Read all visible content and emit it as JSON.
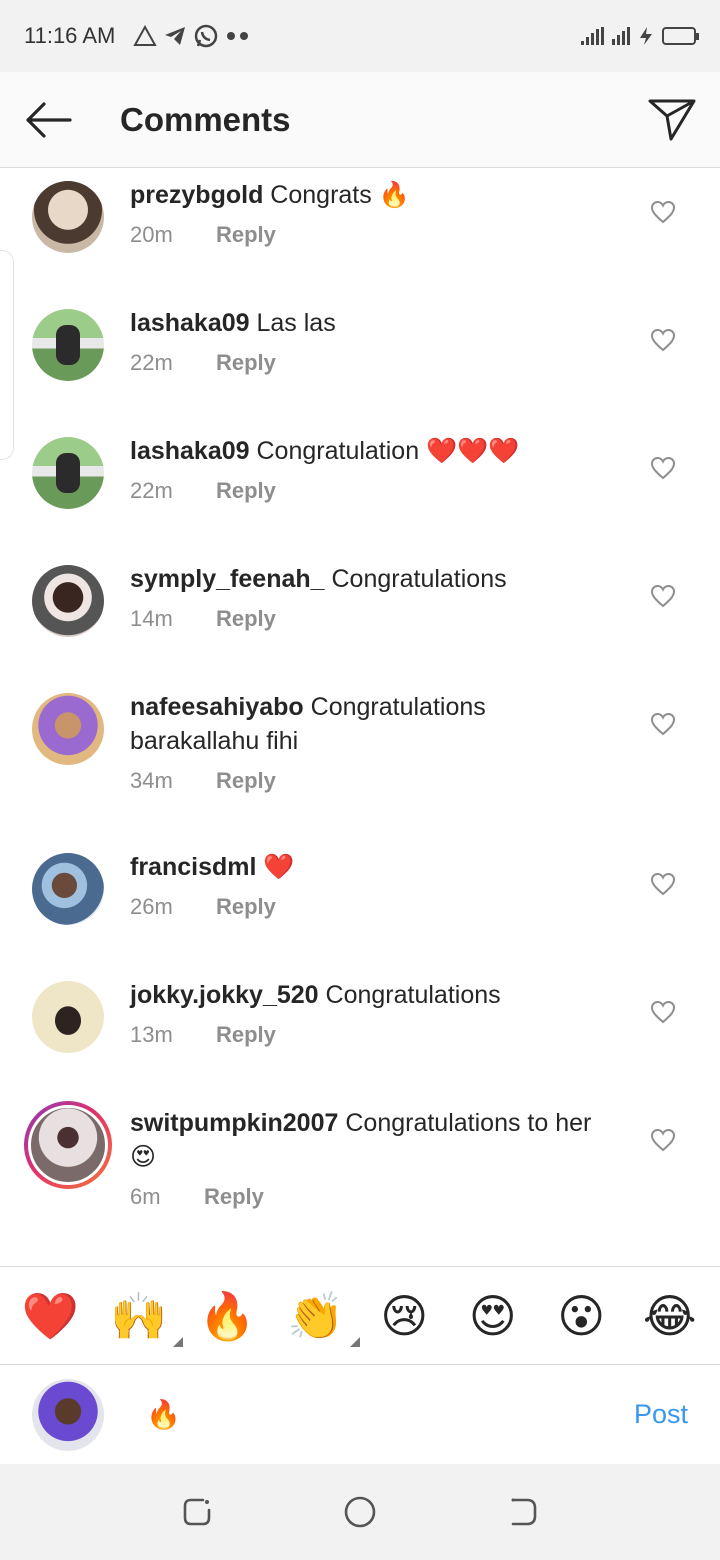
{
  "status_bar": {
    "time": "11:16 AM"
  },
  "header": {
    "title": "Comments"
  },
  "comments": [
    {
      "username": "prezybgold",
      "text": "Congrats 🔥",
      "time": "20m",
      "reply": "Reply",
      "avatar_colors": [
        "#c9b8a6",
        "#6b4a3a"
      ]
    },
    {
      "username": "lashaka09",
      "text": "Las las",
      "time": "22m",
      "reply": "Reply",
      "avatar_colors": [
        "#7cb36b",
        "#2b2b2b"
      ]
    },
    {
      "username": "lashaka09",
      "text": "Congratulation ❤️❤️❤️",
      "time": "22m",
      "reply": "Reply",
      "avatar_colors": [
        "#7cb36b",
        "#2b2b2b"
      ]
    },
    {
      "username": "symply_feenah_",
      "text": "Congratulations",
      "time": "14m",
      "reply": "Reply",
      "avatar_colors": [
        "#d9c9c5",
        "#2a1c1a"
      ]
    },
    {
      "username": "nafeesahiyabo",
      "text": "Congratulations barakallahu fihi",
      "time": "34m",
      "reply": "Reply",
      "avatar_colors": [
        "#b07ad6",
        "#e0b880"
      ]
    },
    {
      "username": "francisdml",
      "text": "❤️",
      "time": "26m",
      "reply": "Reply",
      "avatar_colors": [
        "#dfe8f0",
        "#5a7fa8"
      ]
    },
    {
      "username": "jokky.jokky_520",
      "text": "Congratulations",
      "time": "13m",
      "reply": "Reply",
      "avatar_colors": [
        "#efe6c8",
        "#2d2320"
      ]
    },
    {
      "username": "switpumpkin2007",
      "text": "Congratulations to her😍",
      "time": "6m",
      "reply": "Reply",
      "avatar_colors": [
        "#7a6a6a",
        "#d8d0d0"
      ]
    }
  ],
  "emoji_bar": [
    "❤️",
    "🙌",
    "🔥",
    "👏",
    "😢",
    "😍",
    "😮",
    "😂"
  ],
  "composer": {
    "draft": "🔥",
    "post_label": "Post"
  },
  "colors": {
    "accent": "#3897f0",
    "muted": "#8e8e8e",
    "text": "#262626",
    "heart": "#e0201f"
  }
}
